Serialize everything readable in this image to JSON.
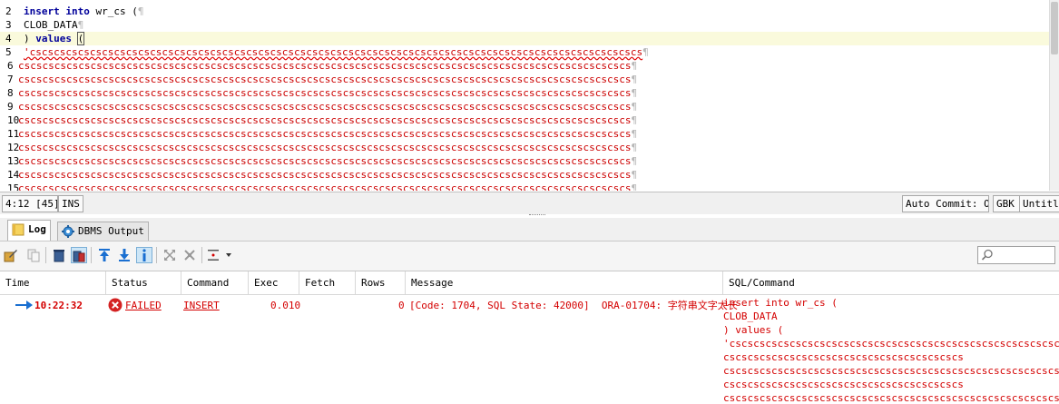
{
  "editor": {
    "lines": [
      {
        "num": "2",
        "kind": "kw2",
        "kw": "insert into",
        "rest": " wr_cs ",
        "paren": "(",
        "pil": "¶"
      },
      {
        "num": "3",
        "kind": "plain",
        "text": "CLOB_DATA",
        "pil": "¶"
      },
      {
        "num": "4",
        "kind": "values",
        "pre": ") ",
        "kw": "values",
        "mid": " ",
        "paren": "("
      },
      {
        "num": "5",
        "kind": "strerr",
        "text": "'cscscscscscscscscscscscscscscscscscscscscscscscscscscscscscscscscscscscscscscscscscscscscscscscscscscs",
        "pil": "¶"
      },
      {
        "num": "6",
        "kind": "str",
        "text": "cscscscscscscscscscscscscscscscscscscscscscscscscscscscscscscscscscscscscscscscscscscscscscscscscscscs",
        "pil": "¶"
      },
      {
        "num": "7",
        "kind": "str",
        "text": "cscscscscscscscscscscscscscscscscscscscscscscscscscscscscscscscscscscscscscscscscscscscscscscscscscscs",
        "pil": "¶"
      },
      {
        "num": "8",
        "kind": "str",
        "text": "cscscscscscscscscscscscscscscscscscscscscscscscscscscscscscscscscscscscscscscscscscscscscscscscscscscs",
        "pil": "¶"
      },
      {
        "num": "9",
        "kind": "str",
        "text": "cscscscscscscscscscscscscscscscscscscscscscscscscscscscscscscscscscscscscscscscscscscscscscscscscscscs",
        "pil": "¶"
      },
      {
        "num": "10",
        "kind": "str",
        "text": "cscscscscscscscscscscscscscscscscscscscscscscscscscscscscscscscscscscscscscscscscscscscscscscscscscscs",
        "pil": "¶"
      },
      {
        "num": "11",
        "kind": "str",
        "text": "cscscscscscscscscscscscscscscscscscscscscscscscscscscscscscscscscscscscscscscscscscscscscscscscscscscs",
        "pil": "¶"
      },
      {
        "num": "12",
        "kind": "str",
        "text": "cscscscscscscscscscscscscscscscscscscscscscscscscscscscscscscscscscscscscscscscscscscscscscscscscscscs",
        "pil": "¶"
      },
      {
        "num": "13",
        "kind": "str",
        "text": "cscscscscscscscscscscscscscscscscscscscscscscscscscscscscscscscscscscscscscscscscscscscscscscscscscscs",
        "pil": "¶"
      },
      {
        "num": "14",
        "kind": "str",
        "text": "cscscscscscscscscscscscscscscscscscscscscscscscscscscscscscscscscscscscscscscscscscscscscscscscscscscs",
        "pil": "¶"
      },
      {
        "num": "15",
        "kind": "str",
        "text": "cscscscscscscscscscscscscscscscscscscscscscscscscscscscscscscscscscscscscscscscscscscscscscscscscscscs",
        "pil": "¶"
      }
    ]
  },
  "status_bar": {
    "position": "4:12 [45]",
    "mode": "INS",
    "auto_commit": "Auto Commit: ON",
    "encoding": "GBK",
    "doc_title": "Untitled"
  },
  "tabs": {
    "log": "Log",
    "dbms_output": "DBMS Output"
  },
  "log": {
    "columns": [
      "Time",
      "Status",
      "Command",
      "Exec",
      "Fetch",
      "Rows",
      "Message",
      "SQL/Command"
    ],
    "rows": [
      {
        "time": "10:22:32",
        "status": "FAILED",
        "command": "INSERT",
        "exec": "0.010",
        "fetch": "",
        "rows": "0",
        "message": "[Code: 1704, SQL State: 42000]  ORA-01704: 字符串文字太长",
        "sql_lines": [
          "insert into wr_cs (",
          "CLOB_DATA",
          ") values (",
          "'cscscscscscscscscscscscscscscscscscscscscscscscscscscscscscs",
          "cscscscscscscscscscscscscscscscscscscscs",
          "cscscscscscscscscscscscscscscscscscscscscscscscscscscscscscscs",
          "cscscscscscscscscscscscscscscscscscscscs",
          "cscscscscscscscscscscscscscscscscscscscscscscscscscscscscscscs"
        ]
      }
    ]
  },
  "colors": {
    "keyword": "#00009a",
    "string": "#cc0000",
    "error": "#d40000",
    "current_line": "#fafadc",
    "arrow": "#1a6fd1"
  }
}
